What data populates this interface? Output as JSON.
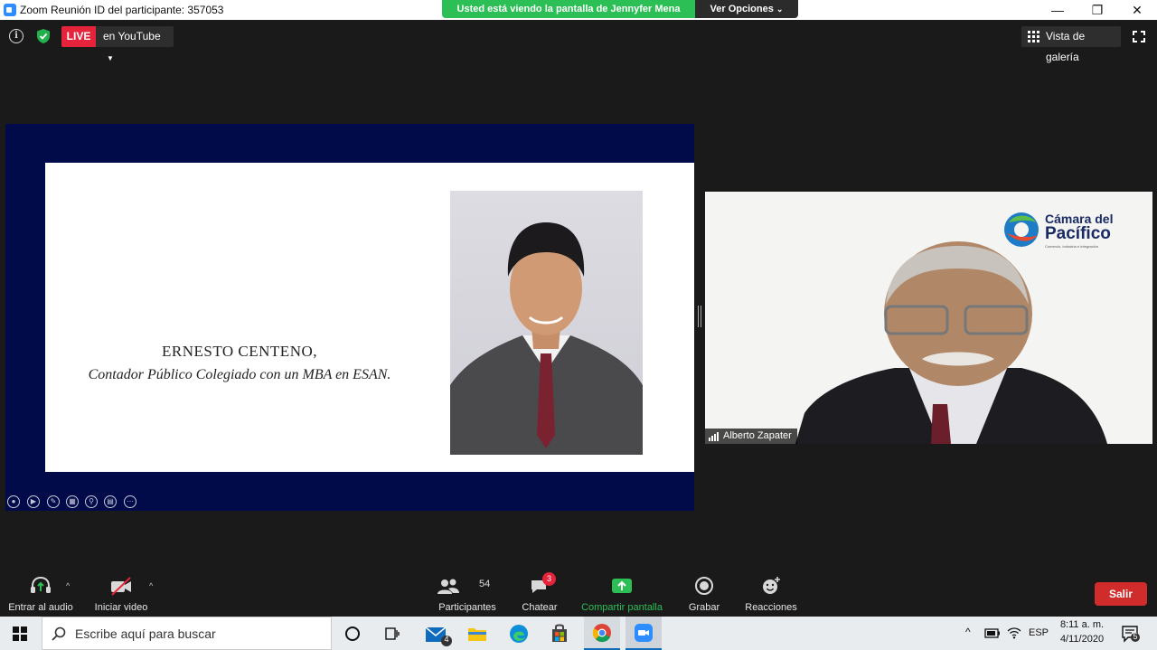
{
  "window": {
    "title": "Zoom Reunión ID del participante: 357053",
    "minimize_glyph": "—",
    "restore_glyph": "❐",
    "close_glyph": "✕"
  },
  "share_banner": {
    "message": "Usted está viendo la pantalla de Jennyfer Mena",
    "options_label": "Ver Opciones"
  },
  "top_bar": {
    "live_label": "LIVE",
    "live_destination": "en YouTube",
    "gallery_label": "Vista de galería"
  },
  "slide": {
    "name": "ERNESTO CENTENO,",
    "role": "Contador Público Colegiado con un MBA en ESAN."
  },
  "video": {
    "participant_name": "Alberto Zapater",
    "logo_line1": "Cámara del",
    "logo_line2": "Pacífico",
    "logo_tagline": "Comercio, Industria e Integración"
  },
  "toolbar": {
    "audio_label": "Entrar al audio",
    "video_label": "Iniciar video",
    "participants_label": "Participantes",
    "participants_count": "54",
    "chat_label": "Chatear",
    "chat_badge": "3",
    "share_label": "Compartir pantalla",
    "record_label": "Grabar",
    "reactions_label": "Reacciones",
    "leave_label": "Salir"
  },
  "taskbar": {
    "search_placeholder": "Escribe aquí para buscar",
    "mail_badge": "4",
    "language": "ESP",
    "time": "8:11 a. m.",
    "date": "4/11/2020",
    "notifications_count": "5"
  },
  "colors": {
    "live_red": "#e5243b",
    "share_green": "#2bbf55",
    "slide_navy": "#020b4a",
    "leave_red": "#d02c2c"
  }
}
